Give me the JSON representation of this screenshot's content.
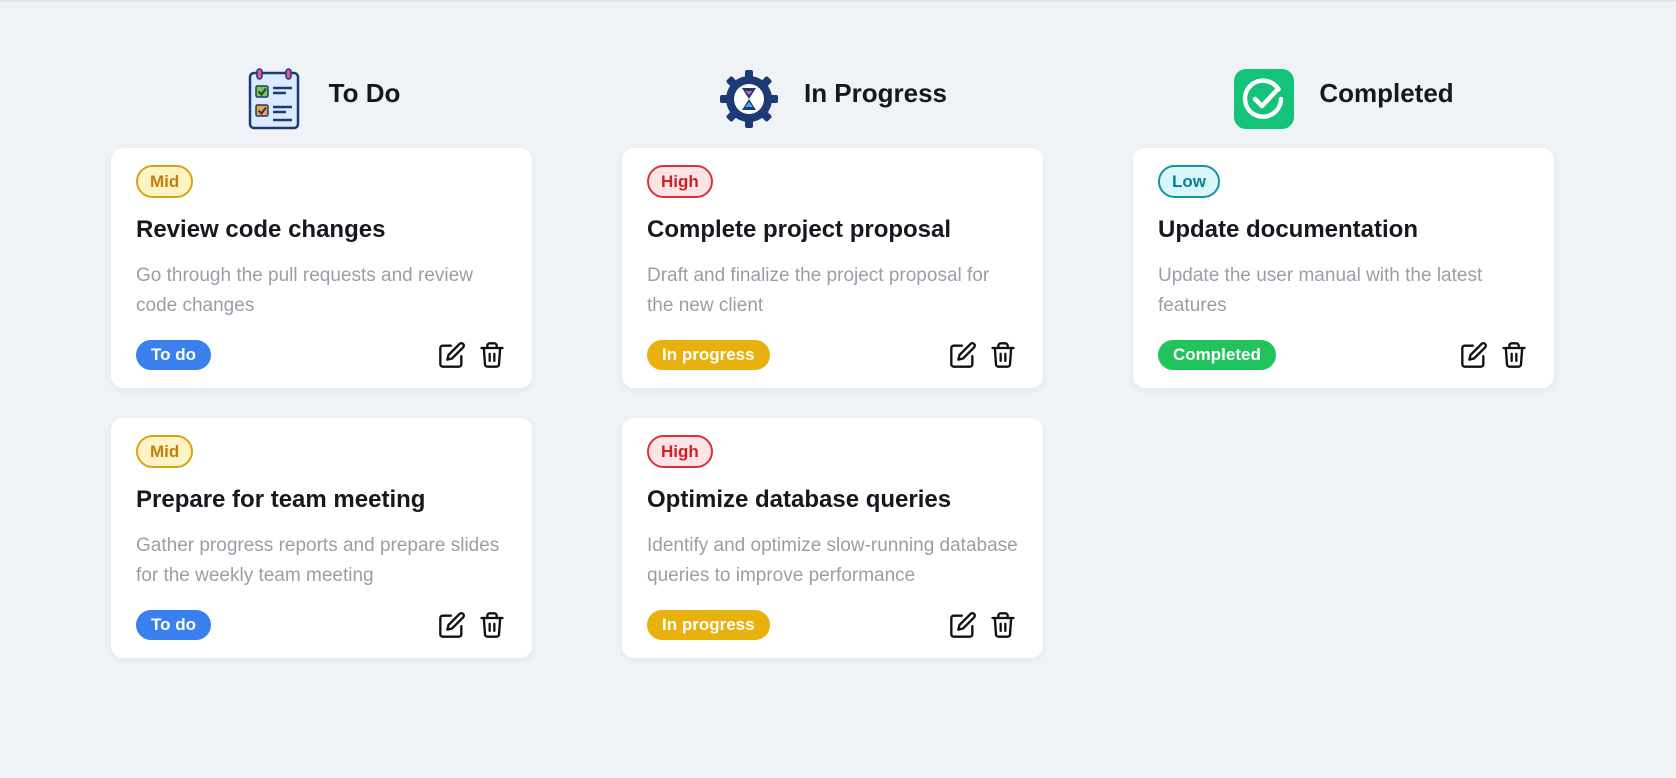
{
  "colors": {
    "background": "#eff3f8",
    "card": "#ffffff",
    "status_todo": "#3a80ef",
    "status_in_progress": "#e9b10e",
    "status_completed": "#21c35c",
    "priority_mid": "#d8a311",
    "priority_high": "#d9323a",
    "priority_low": "#1592a8"
  },
  "columns": [
    {
      "title": "To Do",
      "icon": "clipboard-checklist-icon",
      "cards": [
        {
          "priority": "Mid",
          "title": "Review code changes",
          "description": "Go through the pull requests and review code changes",
          "status": "To do"
        },
        {
          "priority": "Mid",
          "title": "Prepare for team meeting",
          "description": "Gather progress reports and prepare slides for the weekly team meeting",
          "status": "To do"
        }
      ]
    },
    {
      "title": "In Progress",
      "icon": "gear-hourglass-icon",
      "cards": [
        {
          "priority": "High",
          "title": "Complete project proposal",
          "description": "Draft and finalize the project proposal for the new client",
          "status": "In progress"
        },
        {
          "priority": "High",
          "title": "Optimize database queries",
          "description": "Identify and optimize slow-running database queries to improve performance",
          "status": "In progress"
        }
      ]
    },
    {
      "title": "Completed",
      "icon": "check-circle-icon",
      "cards": [
        {
          "priority": "Low",
          "title": "Update documentation",
          "description": "Update the user manual with the latest features",
          "status": "Completed"
        }
      ]
    }
  ],
  "actions": {
    "edit_icon": "edit-icon",
    "delete_icon": "trash-icon"
  }
}
